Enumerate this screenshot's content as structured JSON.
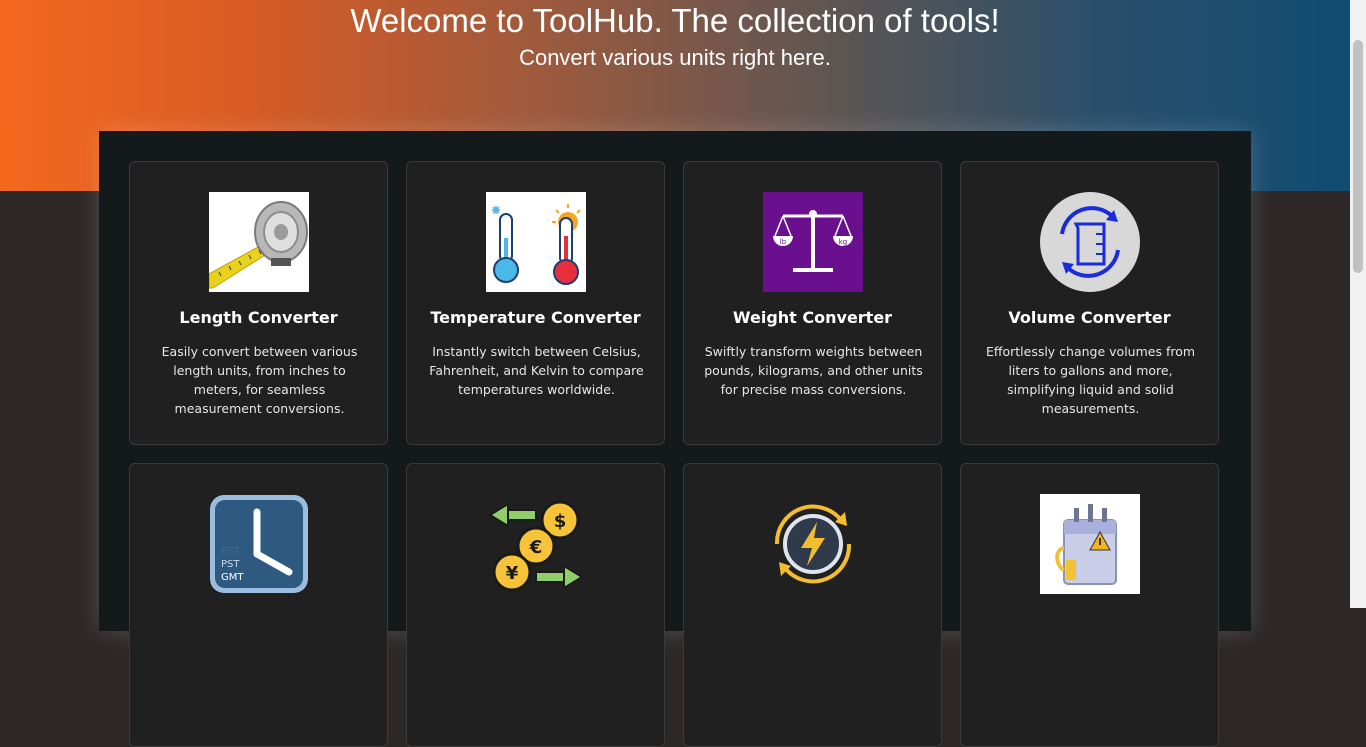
{
  "header": {
    "title": "Welcome to ToolHub. The collection of tools!",
    "subtitle": "Convert various units right here."
  },
  "cards": [
    {
      "title": "Length Converter",
      "description": "Easily convert between various length units, from inches to meters, for seamless measurement conversions.",
      "icon": "tape-measure-icon"
    },
    {
      "title": "Temperature Converter",
      "description": "Instantly switch between Celsius, Fahrenheit, and Kelvin to compare temperatures worldwide.",
      "icon": "thermometer-icon"
    },
    {
      "title": "Weight Converter",
      "description": "Swiftly transform weights between pounds, kilograms, and other units for precise mass conversions.",
      "icon": "scale-icon"
    },
    {
      "title": "Volume Converter",
      "description": "Effortlessly change volumes from liters to gallons and more, simplifying liquid and solid measurements.",
      "icon": "beaker-icon"
    },
    {
      "title": "",
      "description": "",
      "icon": "clock-icon",
      "clock_labels": [
        "EST",
        "PST",
        "GMT"
      ]
    },
    {
      "title": "",
      "description": "",
      "icon": "currency-exchange-icon",
      "currency_symbols": [
        "$",
        "€",
        "¥"
      ]
    },
    {
      "title": "",
      "description": "",
      "icon": "energy-icon"
    },
    {
      "title": "",
      "description": "",
      "icon": "battery-icon"
    }
  ],
  "weight_icon_labels": [
    "lb",
    "kg"
  ],
  "colors": {
    "hero_start": "#f5681e",
    "hero_end": "#0e4c74",
    "panel": "#14191b",
    "card": "#202020",
    "page": "#2d2827"
  }
}
